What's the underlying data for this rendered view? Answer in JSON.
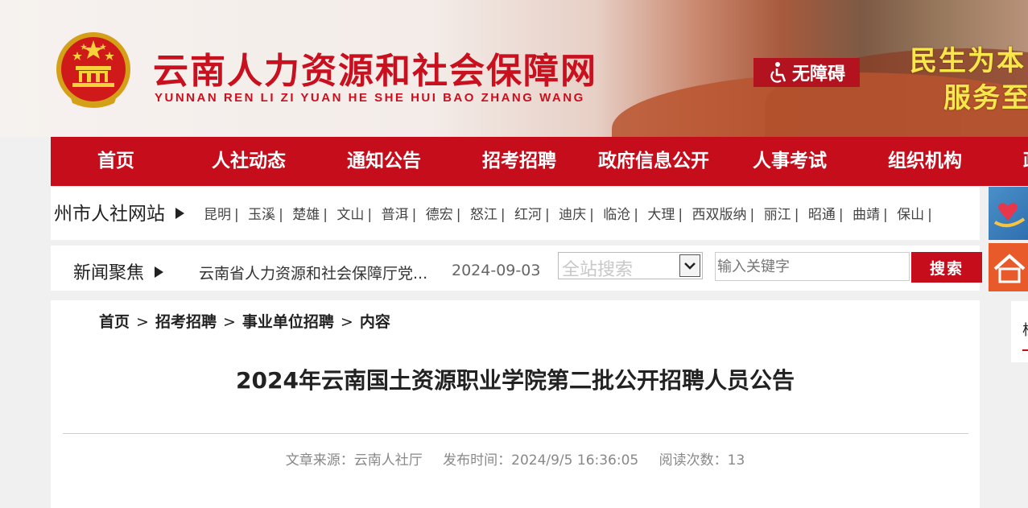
{
  "header": {
    "site_title": "云南人力资源和社会保障网",
    "site_pinyin": "YUNNAN REN LI ZI YUAN HE SHE HUI BAO ZHANG WANG",
    "accessibility_label": "无障碍",
    "slogan_line1": "民生为本",
    "slogan_line2": "服务至"
  },
  "nav": {
    "items": [
      "首页",
      "人社动态",
      "通知公告",
      "招考招聘",
      "政府信息公开",
      "人事考试",
      "组织机构",
      "政"
    ]
  },
  "city_sites": {
    "label": "州市人社网站",
    "cities": [
      "昆明",
      "玉溪",
      "楚雄",
      "文山",
      "普洱",
      "德宏",
      "怒江",
      "红河",
      "迪庆",
      "临沧",
      "大理",
      "西双版纳",
      "丽江",
      "昭通",
      "曲靖",
      "保山"
    ],
    "separator": "|"
  },
  "news": {
    "label": "新闻聚焦",
    "headline": "云南省人力资源和社会保障厅党...",
    "date": "2024-09-03"
  },
  "search": {
    "scope_value": "全站搜索",
    "placeholder": "输入关键字",
    "button_label": "搜索"
  },
  "breadcrumb": {
    "items": [
      "首页",
      "招考招聘",
      "事业单位招聘",
      "内容"
    ],
    "separator": ">"
  },
  "article": {
    "title": "2024年云南国土资源职业学院第二批公开招聘人员公告",
    "source_label": "文章来源：",
    "source": "云南人社厅",
    "publish_label": "发布时间：",
    "publish_time": "2024/9/5 16:36:05",
    "views_label": "阅读次数：",
    "views": "13"
  },
  "side": {
    "panel_text": "栏"
  },
  "colors": {
    "brand_red": "#c50d1c",
    "slogan_yellow": "#f6e84a"
  },
  "icons": {
    "emblem": "national-emblem-icon",
    "accessibility": "wheelchair-icon",
    "arrow": "triangle-right-icon",
    "dropdown": "chevron-down-icon"
  }
}
